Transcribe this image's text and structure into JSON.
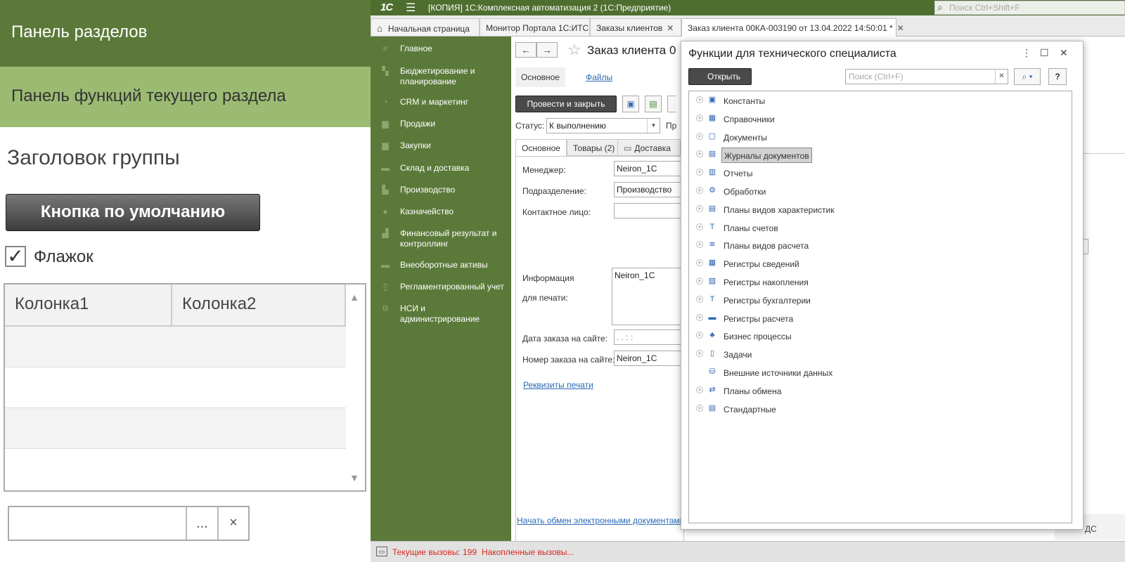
{
  "demo": {
    "sections_panel": "Панель разделов",
    "functions_panel": "Панель функций текущего раздела",
    "group_header": "Заголовок группы",
    "default_button": "Кнопка по умолчанию",
    "checkbox_label": "Флажок",
    "columns": [
      "Колонка1",
      "Колонка2"
    ],
    "field_dots": "...",
    "field_clear": "×"
  },
  "app": {
    "logo": "1С",
    "window_title": "[КОПИЯ] 1С:Комплексная автоматизация 2  (1С:Предприятие)",
    "search_placeholder": "Поиск Ctrl+Shift+F",
    "tabs": [
      "Начальная страница",
      "Монитор Портала 1С:ИТС",
      "Заказы клиентов",
      "Заказ клиента 00КА-003190 от 13.04.2022 14:50:01 *"
    ],
    "sidebar": [
      "Главное",
      "Бюджетирование и планирование",
      "CRM и маркетинг",
      "Продажи",
      "Закупки",
      "Склад и доставка",
      "Производство",
      "Казначейство",
      "Финансовый результат и контроллинг",
      "Внеоборотные активы",
      "Регламентированный учет",
      "НСИ и администрирование"
    ],
    "form": {
      "title": "Заказ клиента 0",
      "subtabs": [
        "Основное",
        "Файлы"
      ],
      "post_close": "Провести и закрыть",
      "status_label": "Статус:",
      "status_value": "К выполнению",
      "status_after": "Пр",
      "inner_tabs": [
        "Основное",
        "Товары (2)",
        "Доставка"
      ],
      "manager_label": "Менеджер:",
      "manager_value": "Neiron_1C",
      "dept_label": "Подразделение:",
      "dept_value": "Производство",
      "contact_label": "Контактное лицо:",
      "info_label_1": "Информация",
      "info_label_2": "для печати:",
      "info_value": "Neiron_1C",
      "site_date_label": "Дата заказа на сайте:",
      "site_date_value": " .  .       :  :",
      "site_num_label": "Номер заказа на сайте:",
      "site_num_value": "Neiron_1C",
      "print_props": "Реквизиты печати",
      "edi_link": "Начать обмен электронными документами",
      "right_fragment": "ДС"
    },
    "status": {
      "current": "Текущие вызовы: 199",
      "accumulated": "Накопленные вызовы..."
    }
  },
  "dialog": {
    "title": "Функции для технического специалиста",
    "open_button": "Открыть",
    "search_placeholder": "Поиск (Ctrl+F)",
    "help": "?",
    "items": [
      {
        "label": "Константы",
        "icon": "constants-icon",
        "glyph": "▣"
      },
      {
        "label": "Справочники",
        "icon": "catalogs-icon",
        "glyph": "▦"
      },
      {
        "label": "Документы",
        "icon": "documents-icon",
        "glyph": "▢"
      },
      {
        "label": "Журналы документов",
        "icon": "doc-journals-icon",
        "glyph": "▤",
        "selected": true
      },
      {
        "label": "Отчеты",
        "icon": "reports-icon",
        "glyph": "▥"
      },
      {
        "label": "Обработки",
        "icon": "processors-icon",
        "glyph": "⚙"
      },
      {
        "label": "Планы видов характеристик",
        "icon": "char-types-icon",
        "glyph": "▤"
      },
      {
        "label": "Планы счетов",
        "icon": "accounts-chart-icon",
        "glyph": "Т"
      },
      {
        "label": "Планы видов расчета",
        "icon": "calc-types-icon",
        "glyph": "≋"
      },
      {
        "label": "Регистры сведений",
        "icon": "info-registers-icon",
        "glyph": "▦"
      },
      {
        "label": "Регистры накопления",
        "icon": "accum-registers-icon",
        "glyph": "▨"
      },
      {
        "label": "Регистры бухгалтерии",
        "icon": "accounting-registers-icon",
        "glyph": "Т"
      },
      {
        "label": "Регистры расчета",
        "icon": "calc-registers-icon",
        "glyph": "▬"
      },
      {
        "label": "Бизнес процессы",
        "icon": "business-processes-icon",
        "glyph": "♣"
      },
      {
        "label": "Задачи",
        "icon": "tasks-icon",
        "glyph": "▯"
      },
      {
        "label": "Внешние источники данных",
        "icon": "external-data-icon",
        "glyph": "⛁",
        "no_expand": true
      },
      {
        "label": "Планы обмена",
        "icon": "exchange-plans-icon",
        "glyph": "⇄"
      },
      {
        "label": "Стандартные",
        "icon": "standard-icon",
        "glyph": "▤"
      }
    ]
  },
  "colors": {
    "brand_dark": "#4e6e2f",
    "brand": "#5b7a3a",
    "brand_light": "#9bbb73",
    "link": "#2a6ab6",
    "status_red": "#d8281e"
  }
}
